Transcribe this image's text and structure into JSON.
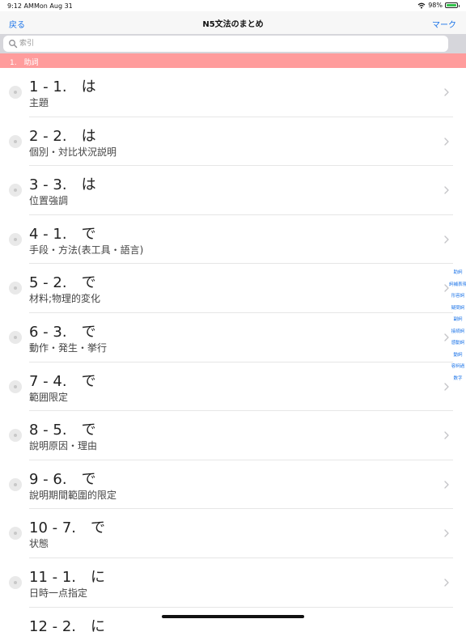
{
  "status": {
    "time": "9:12 AM",
    "date": "Mon Aug 31",
    "battery": "98%",
    "battery_level": 0.98
  },
  "nav": {
    "back": "戻る",
    "title": "N5文法のまとめ",
    "mark": "マーク"
  },
  "search": {
    "placeholder": "索引",
    "value": ""
  },
  "section": {
    "label": "1.　助詞"
  },
  "rows": [
    {
      "title": "1 - 1.　は",
      "sub": "主題"
    },
    {
      "title": "2 - 2.　は",
      "sub": "個別・対比状況説明"
    },
    {
      "title": "3 - 3.　は",
      "sub": "位置強調"
    },
    {
      "title": "4 - 1.　で",
      "sub": "手段・方法(表工具・語言)"
    },
    {
      "title": "5 - 2.　で",
      "sub": "材料;物理的変化"
    },
    {
      "title": "6 - 3.　で",
      "sub": "動作・発生・挙行"
    },
    {
      "title": "7 - 4.　で",
      "sub": "範囲限定"
    },
    {
      "title": "8 - 5.　で",
      "sub": "說明原因・理由"
    },
    {
      "title": "9 - 6.　で",
      "sub": "說明期間範圍的限定"
    },
    {
      "title": "10 - 7.　で",
      "sub": "状態"
    },
    {
      "title": "11 - 1.　に",
      "sub": "日時一点指定"
    }
  ],
  "peek": {
    "title": "12 - 2.　に"
  },
  "index": [
    "助詞",
    "詞補表現",
    "形容詞",
    "疑問詞",
    "副詞",
    "接続詞",
    "感動詞",
    "動詞",
    "容詞過",
    "数字"
  ],
  "colors": {
    "accent": "#1a73e8",
    "section": "#ff9c9c"
  }
}
